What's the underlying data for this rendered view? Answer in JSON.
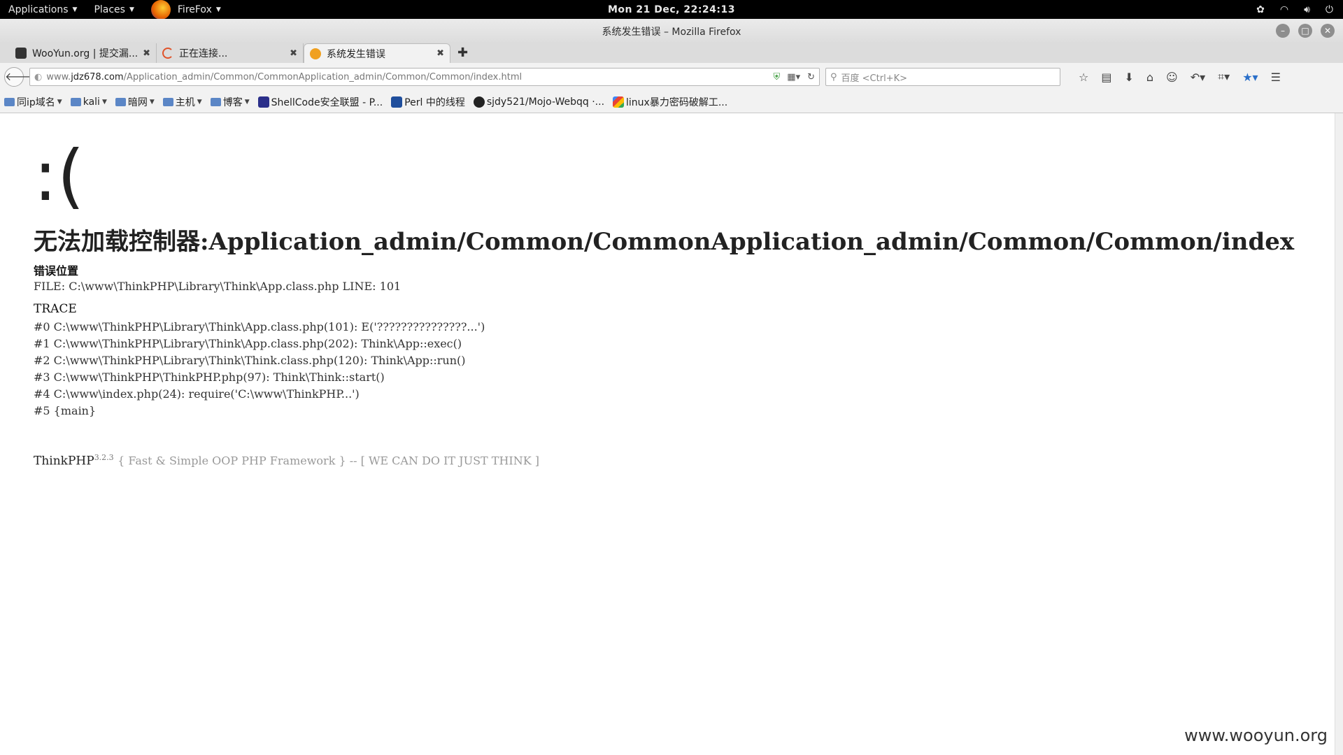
{
  "topbar": {
    "applications_label": "Applications",
    "places_label": "Places",
    "firefox_label": "FireFox",
    "clock": "Mon 21 Dec, 22:24:13"
  },
  "window": {
    "title": "系统发生错误 – Mozilla Firefox"
  },
  "tabs": [
    {
      "label": "WooYun.org | 提交漏...",
      "favicon_color": "#333333"
    },
    {
      "label": "正在连接...",
      "favicon_color": "#e0532a"
    },
    {
      "label": "系统发生错误",
      "favicon_color": "#f0a020"
    }
  ],
  "navbar": {
    "url_host": "www.jdz678.com",
    "url_prefix": "www.",
    "url_domain": "jdz678.com",
    "url_path": "/Application_admin/Common/CommonApplication_admin/Common/Common/index.html",
    "search_placeholder": "百度 <Ctrl+K>"
  },
  "bookmarks": [
    {
      "label": "同ip域名",
      "type": "folder"
    },
    {
      "label": "kali",
      "type": "folder"
    },
    {
      "label": "暗网",
      "type": "folder"
    },
    {
      "label": "主机",
      "type": "folder"
    },
    {
      "label": "博客",
      "type": "folder"
    },
    {
      "label": "ShellCode安全联盟 - P...",
      "type": "link"
    },
    {
      "label": "Perl 中的线程",
      "type": "link"
    },
    {
      "label": "sjdy521/Mojo-Webqq ·...",
      "type": "link"
    },
    {
      "label": "linux暴力密码破解工...",
      "type": "link"
    }
  ],
  "page": {
    "face": ":(",
    "error_title": "无法加载控制器:Application_admin/Common/CommonApplication_admin/Common/Common/index",
    "location_heading": "错误位置",
    "file_line": "FILE: C:\\www\\ThinkPHP\\Library\\Think\\App.class.php    LINE: 101",
    "trace_heading": "TRACE",
    "trace": [
      "#0 C:\\www\\ThinkPHP\\Library\\Think\\App.class.php(101): E('???????????????...')",
      "#1 C:\\www\\ThinkPHP\\Library\\Think\\App.class.php(202): Think\\App::exec()",
      "#2 C:\\www\\ThinkPHP\\Library\\Think\\Think.class.php(120): Think\\App::run()",
      "#3 C:\\www\\ThinkPHP\\ThinkPHP.php(97): Think\\Think::start()",
      "#4 C:\\www\\index.php(24): require('C:\\www\\ThinkPHP...')",
      "#5 {main}"
    ],
    "framework": "ThinkPHP",
    "version": "3.2.3",
    "tagline": "{ Fast & Simple OOP PHP Framework } -- [ WE CAN DO IT JUST THINK ]"
  },
  "watermark": "www.wooyun.org"
}
